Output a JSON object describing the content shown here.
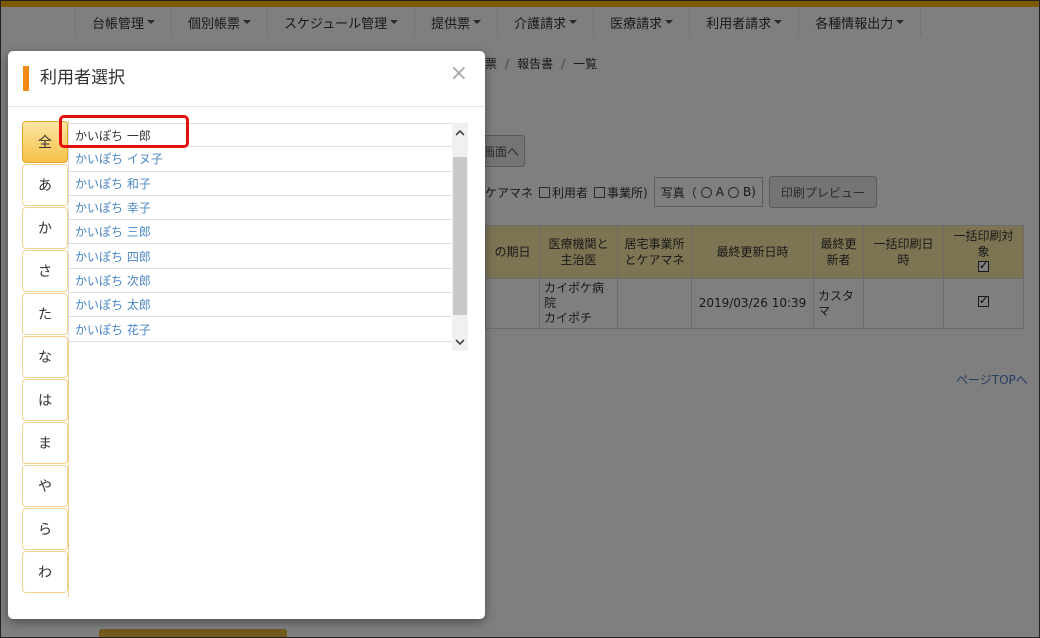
{
  "nav": {
    "items": [
      "台帳管理",
      "個別帳票",
      "スケジュール管理",
      "提供票",
      "介護請求",
      "医療請求",
      "利用者請求",
      "各種情報出力"
    ]
  },
  "background": {
    "breadcrumb": [
      "票",
      "報告書",
      "一覧"
    ],
    "button_screen": "画面へ",
    "filters": {
      "caremane": "ケアマネ",
      "user": "利用者",
      "office": "事業所)",
      "photo_label": "写真（",
      "photo_a": "A",
      "photo_b": "B)",
      "preview_button": "印刷プレビュー"
    },
    "table": {
      "headers": [
        "の期日",
        "医療機関と主治医",
        "居宅事業所とケアマネ",
        "最終更新日時",
        "最終更新者",
        "一括印刷日時",
        "一括印刷対象"
      ],
      "row": {
        "hospital": "カイポケ病院",
        "doctor": "カイポチ",
        "updated_at": "2019/03/26 10:39",
        "updated_by": "カスタマ"
      }
    },
    "page_top": "ページTOPへ"
  },
  "modal": {
    "title": "利用者選択",
    "close": "×",
    "kana": [
      "全",
      "あ",
      "か",
      "さ",
      "た",
      "な",
      "は",
      "ま",
      "や",
      "ら",
      "わ"
    ],
    "active_kana": "全",
    "users": [
      "かいぽち 一郎",
      "かいぽち イヌ子",
      "かいぽち 和子",
      "かいぽち 幸子",
      "かいぽち 三郎",
      "かいぽち 四郎",
      "かいぽち 次郎",
      "かいぽち 太郎",
      "かいぽち 花子"
    ],
    "highlighted_user": "かいぽち 一郎"
  },
  "colors": {
    "accent": "#f58a16",
    "header_bg": "#fbe9a8",
    "link": "#4a86c5",
    "highlight": "#e01010"
  }
}
